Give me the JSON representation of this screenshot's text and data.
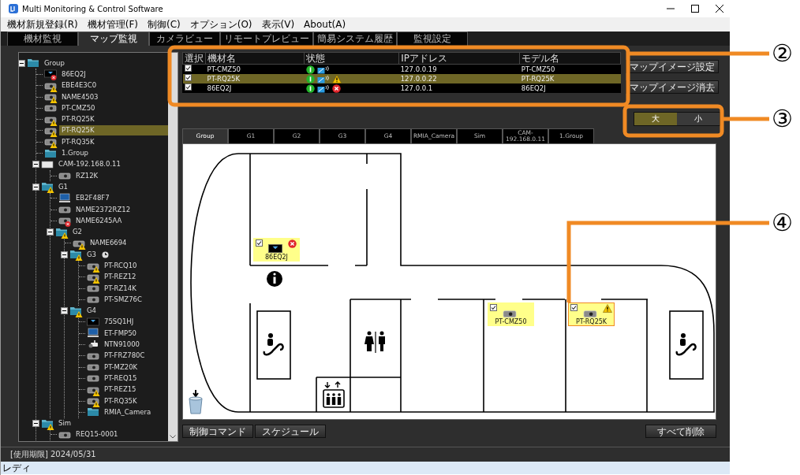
{
  "window": {
    "title": "Multi Monitoring & Control Software"
  },
  "menu": [
    "機材新規登録(R)",
    "機材管理(F)",
    "制御(C)",
    "オプション(O)",
    "表示(V)",
    "About(A)"
  ],
  "main_tabs": [
    {
      "label": "機材監視",
      "selected": false
    },
    {
      "label": "マップ監視",
      "selected": true
    },
    {
      "label": "カメラビュー",
      "selected": false
    },
    {
      "label": "リモートプレビュー",
      "selected": false
    },
    {
      "label": "簡易システム履歴",
      "selected": false
    },
    {
      "label": "監視設定",
      "selected": false
    }
  ],
  "tree": {
    "label": "Group",
    "kind": "folder",
    "warning": false,
    "error": false,
    "expanded": true,
    "selected": false,
    "children": [
      {
        "label": "86EQ2J",
        "kind": "display",
        "warning": false,
        "error": true,
        "selected": false
      },
      {
        "label": "EBE4E3C0",
        "kind": "projector",
        "warning": true,
        "error": false,
        "selected": false
      },
      {
        "label": "NAME4503",
        "kind": "projector",
        "warning": true,
        "error": false,
        "selected": false
      },
      {
        "label": "PT-CMZ50",
        "kind": "projector",
        "warning": false,
        "error": false,
        "selected": false
      },
      {
        "label": "PT-RQ25K",
        "kind": "projector",
        "warning": true,
        "error": false,
        "selected": false
      },
      {
        "label": "PT-RQ25K",
        "kind": "projector",
        "warning": true,
        "error": false,
        "selected": true
      },
      {
        "label": "PT-RQ35K",
        "kind": "projector",
        "warning": true,
        "error": false,
        "selected": false
      },
      {
        "label": "1.Group",
        "kind": "folder",
        "warning": false,
        "error": false,
        "selected": false
      },
      {
        "label": "CAM-192.168.0.11",
        "kind": "unit",
        "warning": false,
        "error": false,
        "expanded": true,
        "selected": false,
        "children": [
          {
            "label": "RZ12K",
            "kind": "projector",
            "warning": false,
            "error": false,
            "selected": false
          }
        ]
      },
      {
        "label": "G1",
        "kind": "folder",
        "warning": true,
        "error": false,
        "expanded": true,
        "selected": false,
        "children": [
          {
            "label": "EB2F48F7",
            "kind": "pc",
            "warning": false,
            "error": false,
            "selected": false
          },
          {
            "label": "NAME2372RZ12",
            "kind": "projector",
            "warning": false,
            "error": false,
            "selected": false
          },
          {
            "label": "NAME6245AA",
            "kind": "projector",
            "warning": false,
            "error": true,
            "selected": false
          },
          {
            "label": "G2",
            "kind": "folder",
            "warning": true,
            "error": false,
            "expanded": true,
            "selected": false,
            "children": [
              {
                "label": "NAME6694",
                "kind": "projector",
                "warning": true,
                "error": false,
                "selected": false
              },
              {
                "label": "G3",
                "kind": "folder",
                "warning": true,
                "error": false,
                "expanded": true,
                "selected": false,
                "scheduled": true,
                "children": [
                  {
                    "label": "PT-RCQ10",
                    "kind": "projector",
                    "warning": true,
                    "error": false,
                    "selected": false
                  },
                  {
                    "label": "PT-REZ12",
                    "kind": "projector",
                    "warning": true,
                    "error": false,
                    "selected": false
                  },
                  {
                    "label": "PT-RZ14K",
                    "kind": "projector",
                    "warning": false,
                    "error": false,
                    "selected": false
                  },
                  {
                    "label": "PT-SMZ76C",
                    "kind": "projector",
                    "warning": false,
                    "error": false,
                    "selected": false
                  }
                ]
              },
              {
                "label": "G4",
                "kind": "folder",
                "warning": true,
                "error": false,
                "expanded": true,
                "selected": false,
                "children": [
                  {
                    "label": "75SQ1HJ",
                    "kind": "display",
                    "warning": false,
                    "error": false,
                    "selected": false
                  },
                  {
                    "label": "ET-FMP50",
                    "kind": "pc",
                    "warning": false,
                    "error": false,
                    "selected": false
                  },
                  {
                    "label": "NTN91000",
                    "kind": "camera",
                    "warning": false,
                    "error": false,
                    "selected": false
                  },
                  {
                    "label": "PT-FRZ780C",
                    "kind": "projector",
                    "warning": false,
                    "error": false,
                    "selected": false
                  },
                  {
                    "label": "PT-MZ20K",
                    "kind": "projector",
                    "warning": false,
                    "error": false,
                    "selected": false
                  },
                  {
                    "label": "PT-REQ15",
                    "kind": "projector",
                    "warning": false,
                    "error": false,
                    "selected": false
                  },
                  {
                    "label": "PT-REZ15",
                    "kind": "projector",
                    "warning": true,
                    "error": false,
                    "selected": false
                  },
                  {
                    "label": "PT-RQ35K",
                    "kind": "projector",
                    "warning": true,
                    "error": false,
                    "selected": false
                  },
                  {
                    "label": "RMIA_Camera",
                    "kind": "folder",
                    "warning": false,
                    "error": false,
                    "selected": false
                  }
                ]
              }
            ]
          }
        ]
      },
      {
        "label": "Sim",
        "kind": "folder",
        "warning": true,
        "error": false,
        "expanded": true,
        "selected": false,
        "children": [
          {
            "label": "REQ15-0001",
            "kind": "projector",
            "warning": false,
            "error": false,
            "selected": false
          }
        ]
      }
    ]
  },
  "device_table": {
    "columns": [
      "選択",
      "機材名",
      "状態",
      "IPアドレス",
      "モデル名"
    ],
    "rows": [
      {
        "checked": true,
        "name": "PT-CMZ50",
        "warning": false,
        "error": false,
        "ip": "127.0.0.19",
        "model": "PT-CMZ50",
        "selected": false
      },
      {
        "checked": true,
        "name": "PT-RQ25K",
        "warning": true,
        "error": false,
        "ip": "127.0.0.22",
        "model": "PT-RQ25K",
        "selected": true
      },
      {
        "checked": true,
        "name": "86EQ2J",
        "warning": false,
        "error": true,
        "ip": "127.0.0.1",
        "model": "86EQ2J",
        "selected": false
      }
    ]
  },
  "map_buttons": [
    "マップイメージ設定",
    "マップイメージ消去"
  ],
  "size_toggle": [
    {
      "label": "大",
      "selected": true
    },
    {
      "label": "小",
      "selected": false
    }
  ],
  "map_tabs": [
    {
      "label": "Group",
      "selected": true
    },
    {
      "label": "G1",
      "selected": false
    },
    {
      "label": "G2",
      "selected": false
    },
    {
      "label": "G3",
      "selected": false
    },
    {
      "label": "G4",
      "selected": false
    },
    {
      "label": "RMIA_Camera",
      "selected": false
    },
    {
      "label": "Sim",
      "selected": false
    },
    {
      "label": "CAM-192.168.0.11",
      "selected": false
    },
    {
      "label": "1.Group",
      "selected": false
    }
  ],
  "map_markers": [
    {
      "name": "86EQ2J",
      "kind": "display",
      "warning": false,
      "error": true,
      "checked": true,
      "selected": false
    },
    {
      "name": "PT-CMZ50",
      "kind": "projector",
      "warning": false,
      "error": false,
      "checked": true,
      "selected": false
    },
    {
      "name": "PT-RQ25K",
      "kind": "projector",
      "warning": true,
      "error": false,
      "checked": true,
      "selected": true
    }
  ],
  "bottom_buttons": [
    "制御コマンド",
    "スケジュール"
  ],
  "clear_button": "すべて削除",
  "footer": "[使用期限] 2024/05/31",
  "status_bar": "レディ",
  "callouts": [
    "②",
    "③",
    "④"
  ]
}
